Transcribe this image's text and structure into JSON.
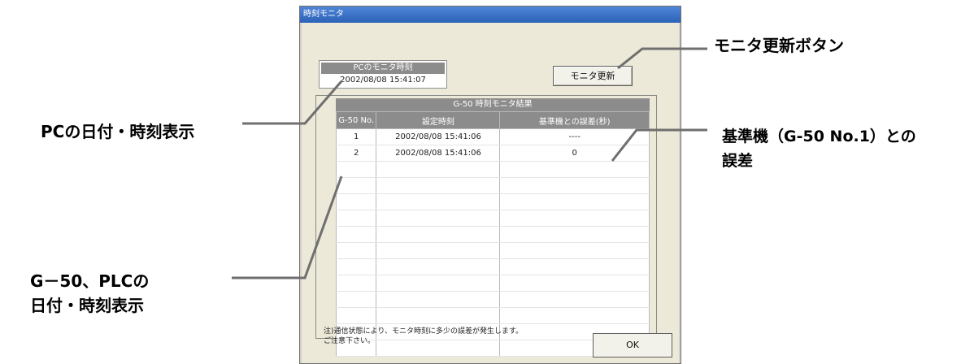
{
  "window": {
    "title": "時刻モニタ"
  },
  "pc_panel": {
    "header": "PCのモニタ時刻",
    "value": "2002/08/08 15:41:07"
  },
  "buttons": {
    "update": "モニタ更新",
    "ok": "OK"
  },
  "results": {
    "title": "G-50 時刻モニタ結果",
    "columns": [
      "G-50 No.",
      "設定時刻",
      "基準機との誤差(秒)"
    ],
    "rows": [
      [
        "1",
        "2002/08/08 15:41:06",
        "----"
      ],
      [
        "2",
        "2002/08/08 15:41:06",
        "0"
      ]
    ]
  },
  "note": {
    "line1": "注)通信状態により、モニタ時刻に多少の誤差が発生します。",
    "line2": "ご注意下さい。"
  },
  "callouts": {
    "pc_time": "PCの日付・時刻表示",
    "g50_line1": "G－50、PLCの",
    "g50_line2": "日付・時刻表示",
    "update_button": "モニタ更新ボタン",
    "reference_line1": "基準機（G-50 No.1）との",
    "reference_line2": "誤差"
  }
}
